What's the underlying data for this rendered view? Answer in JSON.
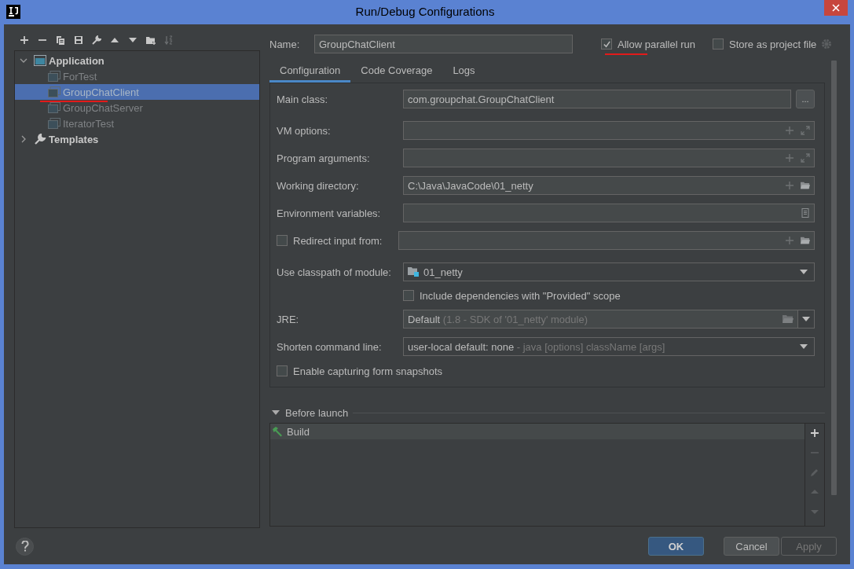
{
  "window": {
    "title": "Run/Debug Configurations"
  },
  "tree": [
    {
      "label": "Application",
      "kind": "group",
      "expanded": true,
      "children": [
        {
          "label": "ForTest",
          "selected": false
        },
        {
          "label": "GroupChatClient",
          "selected": true
        },
        {
          "label": "GroupChatServer",
          "selected": false
        },
        {
          "label": "IteratorTest",
          "selected": false
        }
      ]
    },
    {
      "label": "Templates",
      "kind": "templates",
      "expanded": false
    }
  ],
  "name": {
    "label": "Name:",
    "value": "GroupChatClient"
  },
  "options": [
    {
      "label": "Allow parallel run",
      "checked": true
    },
    {
      "label": "Store as project file",
      "checked": false
    }
  ],
  "tabs": [
    {
      "label": "Configuration",
      "selected": true
    },
    {
      "label": "Code Coverage",
      "selected": false
    },
    {
      "label": "Logs",
      "selected": false
    }
  ],
  "fields": [
    {
      "kind": "text",
      "label": "Main class:",
      "value": "com.groupchat.GroupChatClient",
      "button": "..."
    },
    {
      "kind": "expandable",
      "label": "VM options:"
    },
    {
      "kind": "expandable",
      "label": "Program arguments:"
    },
    {
      "kind": "folder",
      "label": "Working directory:",
      "value": "C:\\Java\\JavaCode\\01_netty"
    },
    {
      "kind": "env",
      "label": "Environment variables:"
    },
    {
      "kind": "redirect",
      "label": "Redirect input from:",
      "checked": false
    },
    {
      "kind": "module",
      "label": "Use classpath of module:",
      "value": "01_netty"
    },
    {
      "kind": "checkbox-indented",
      "label": "Include dependencies with \"Provided\" scope",
      "checked": false
    },
    {
      "kind": "jre",
      "label": "JRE:",
      "value": "Default",
      "hint": "(1.8 - SDK of '01_netty' module)"
    },
    {
      "kind": "select",
      "label": "Shorten command line:",
      "value": "user-local default: none",
      "hint": "- java [options] className [args]"
    },
    {
      "kind": "checkbox",
      "label": "Enable capturing form snapshots",
      "checked": false
    }
  ],
  "before_launch": {
    "title": "Before launch",
    "expanded": true,
    "items": [
      {
        "label": "Build",
        "selected": true
      }
    ]
  },
  "buttons": [
    {
      "label": "OK",
      "default": true,
      "disabled": false
    },
    {
      "label": "Cancel",
      "default": false,
      "disabled": false
    },
    {
      "label": "Apply",
      "default": false,
      "disabled": true
    }
  ]
}
